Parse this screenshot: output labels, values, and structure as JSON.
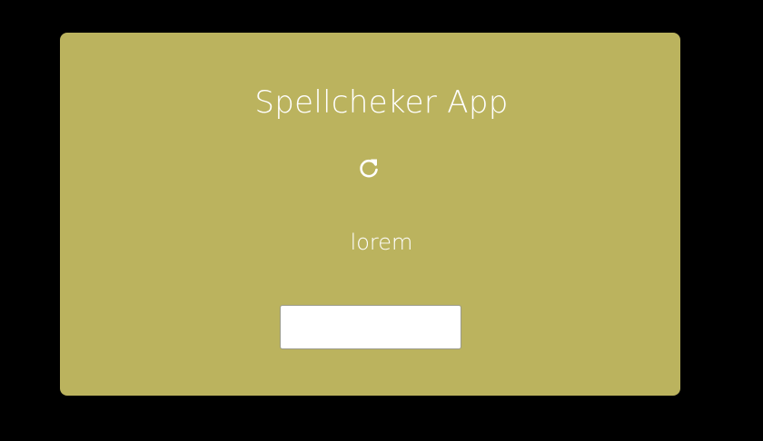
{
  "app": {
    "title": "Spellcheker App",
    "accent_color": "#bbb35e",
    "background_color": "#000000"
  },
  "refresh": {
    "icon": "refresh-icon"
  },
  "word": {
    "text": "lorem"
  },
  "answer_input": {
    "value": "",
    "placeholder": ""
  }
}
